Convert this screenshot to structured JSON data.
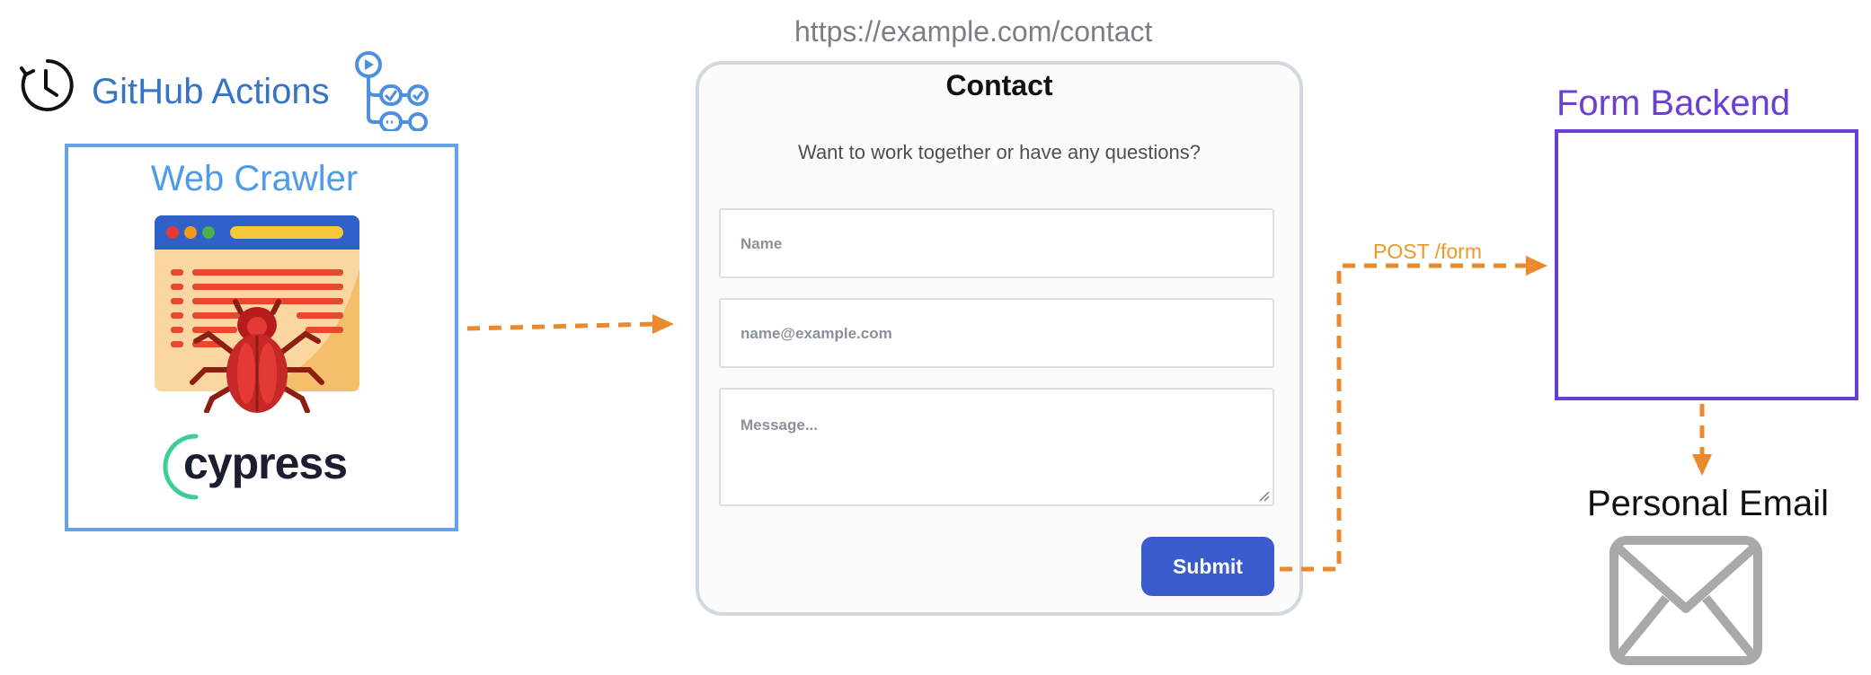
{
  "github_actions": {
    "title": "GitHub Actions",
    "clock_icon": "clock-refresh-icon",
    "logo_icon": "github-actions-workflow-icon"
  },
  "crawler": {
    "title": "Web Crawler",
    "illustration_icon": "browser-bug-icon",
    "framework_logo": "cypress"
  },
  "contact_page": {
    "url": "https://example.com/contact",
    "title": "Contact",
    "subtitle": "Want to work together or have any questions?",
    "name_placeholder": "Name",
    "email_placeholder": "name@example.com",
    "message_placeholder": "Message...",
    "submit_label": "Submit"
  },
  "flow": {
    "post_label": "POST /form"
  },
  "backend": {
    "title": "Form Backend"
  },
  "email": {
    "title": "Personal Email",
    "icon": "envelope-icon"
  },
  "colors": {
    "arrow": "#ea8a2e",
    "crawler_border": "#65a3e6",
    "backend_border": "#6a3fd4",
    "submit": "#3a5ccc",
    "github_blue": "#3575c4"
  }
}
